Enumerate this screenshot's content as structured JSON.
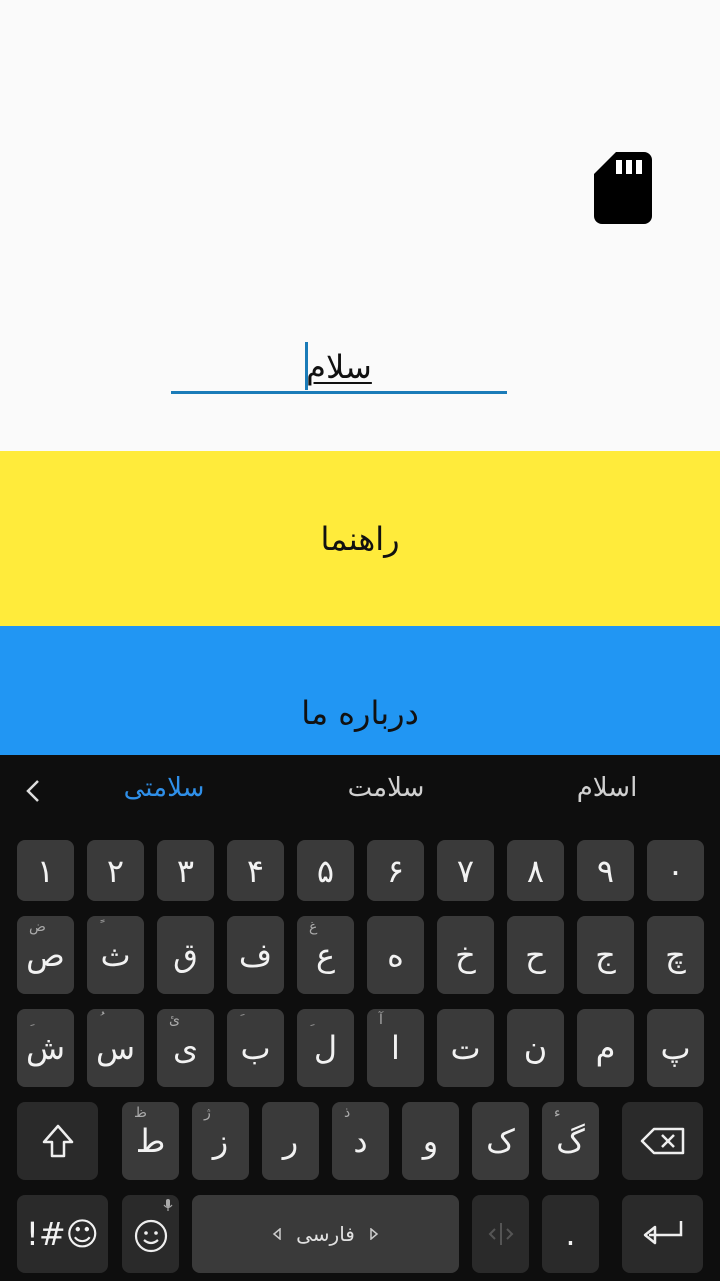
{
  "app": {
    "input_value": "سلام",
    "help_button_label": "راهنما",
    "about_button_label": "درباره ما"
  },
  "keyboard": {
    "suggestions": [
      "سلامتی",
      "سلامت",
      "اسلام"
    ],
    "row_numbers": [
      "۱",
      "۲",
      "۳",
      "۴",
      "۵",
      "۶",
      "۷",
      "۸",
      "۹",
      "۰"
    ],
    "row1": [
      {
        "k": "ص",
        "h": "ض"
      },
      {
        "k": "ث",
        "h": "ً"
      },
      {
        "k": "ق",
        "h": ""
      },
      {
        "k": "ف",
        "h": ""
      },
      {
        "k": "ع",
        "h": "غ"
      },
      {
        "k": "ه",
        "h": ""
      },
      {
        "k": "خ",
        "h": ""
      },
      {
        "k": "ح",
        "h": ""
      },
      {
        "k": "ج",
        "h": ""
      },
      {
        "k": "چ",
        "h": ""
      }
    ],
    "row2": [
      {
        "k": "ش",
        "h": "ِ"
      },
      {
        "k": "س",
        "h": "ُ"
      },
      {
        "k": "ی",
        "h": "ئ"
      },
      {
        "k": "ب",
        "h": "َ"
      },
      {
        "k": "ل",
        "h": "ِ"
      },
      {
        "k": "ا",
        "h": "آ"
      },
      {
        "k": "ت",
        "h": ""
      },
      {
        "k": "ن",
        "h": ""
      },
      {
        "k": "م",
        "h": ""
      },
      {
        "k": "پ",
        "h": ""
      }
    ],
    "row3": [
      {
        "k": "ط",
        "h": "ظ"
      },
      {
        "k": "ز",
        "h": "ژ"
      },
      {
        "k": "ر",
        "h": ""
      },
      {
        "k": "د",
        "h": "ذ"
      },
      {
        "k": "و",
        "h": ""
      },
      {
        "k": "ک",
        "h": ""
      },
      {
        "k": "گ",
        "h": "ء"
      }
    ],
    "symbols_label": "!#☺",
    "space_label": "فارسی",
    "period_label": "."
  },
  "colors": {
    "yellow": "#ffeb3b",
    "blue": "#2196f3",
    "accent": "#1a7bb8",
    "suggestion_active": "#2f8fe8"
  }
}
